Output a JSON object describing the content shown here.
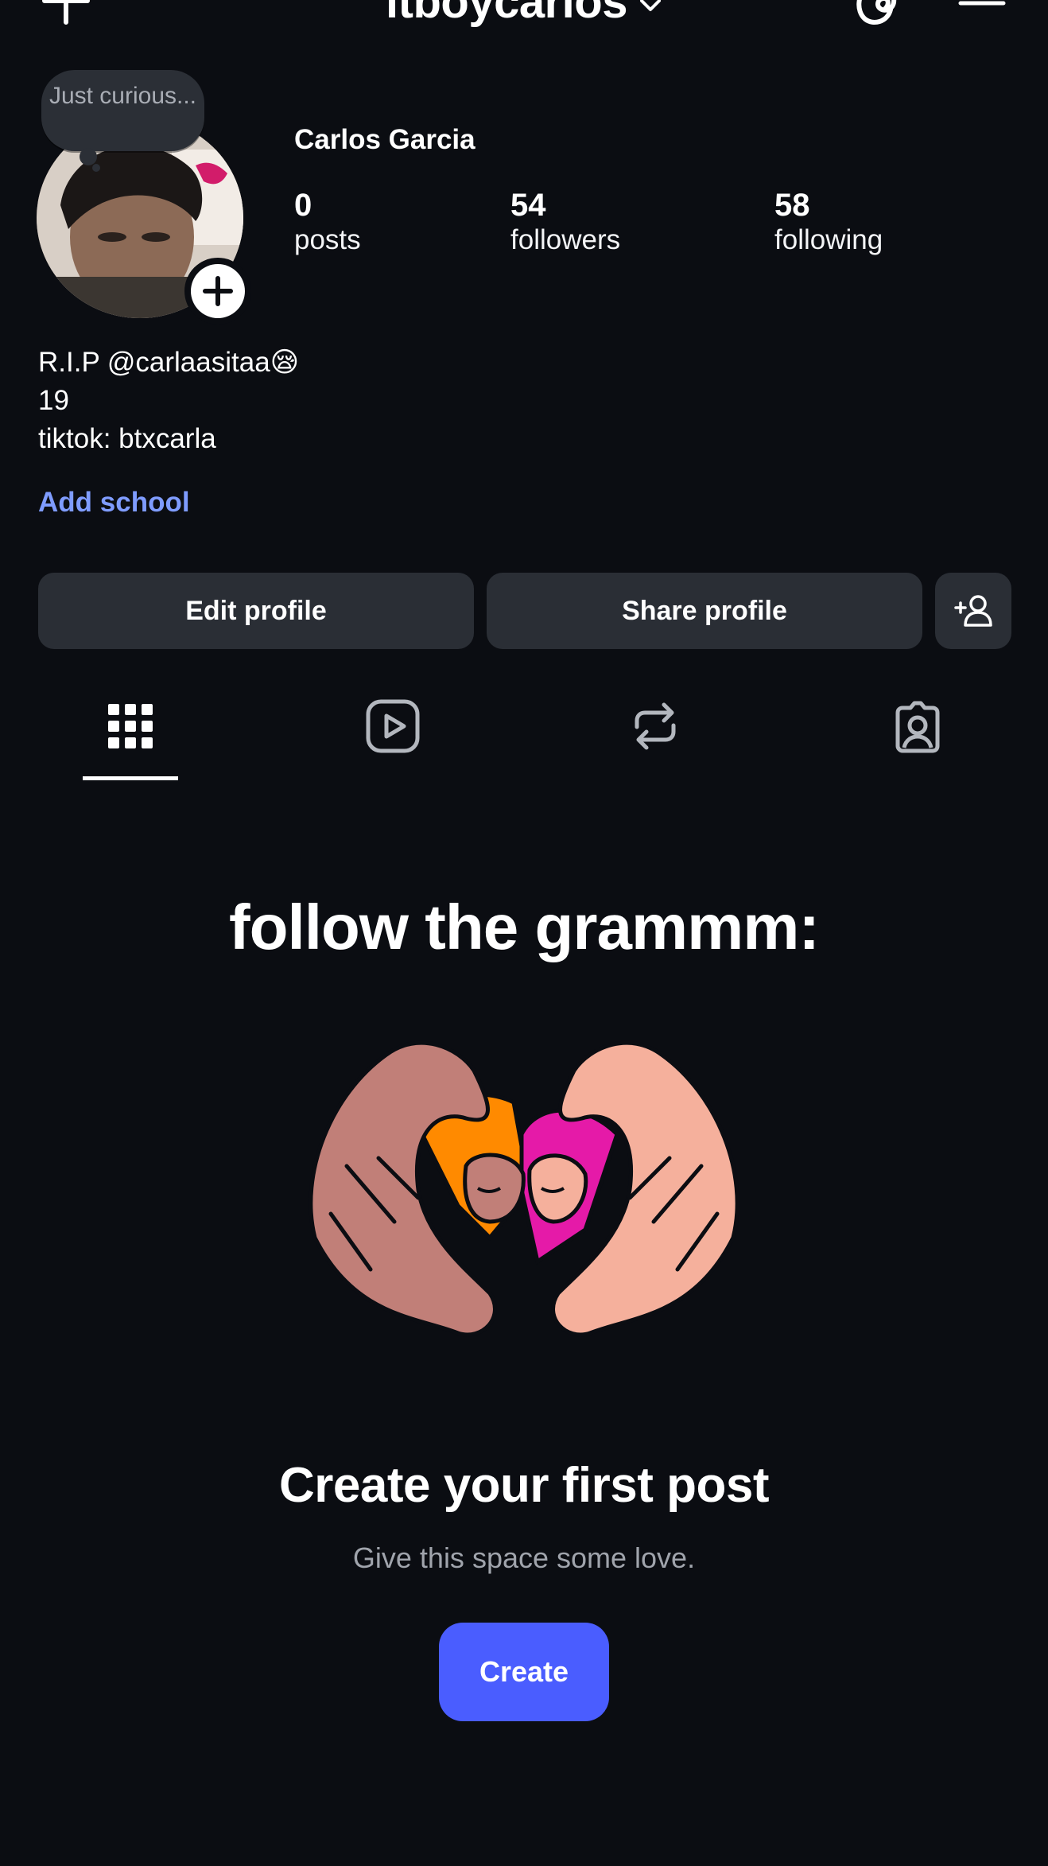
{
  "header": {
    "username": "itboycarlos"
  },
  "profile": {
    "note": "Just curious...",
    "full_name": "Carlos Garcia",
    "stats": [
      {
        "value": "0",
        "label": "posts"
      },
      {
        "value": "54",
        "label": "followers"
      },
      {
        "value": "58",
        "label": "following"
      }
    ],
    "bio_lines": [
      "R.I.P @carlaasitaa😪",
      "19",
      "tiktok: btxcarla"
    ],
    "add_school": "Add school"
  },
  "actions": {
    "edit_profile": "Edit profile",
    "share_profile": "Share profile"
  },
  "tabs": [
    {
      "icon": "grid-icon",
      "active": true
    },
    {
      "icon": "reels-icon",
      "active": false
    },
    {
      "icon": "reposts-icon",
      "active": false
    },
    {
      "icon": "tagged-icon",
      "active": false
    }
  ],
  "empty_state": {
    "banner": "follow the grammm:",
    "title": "Create your first post",
    "subtitle": "Give this space some love.",
    "button": "Create"
  },
  "colors": {
    "background": "#0b0d12",
    "button_bg": "#2a2e35",
    "link": "#7f9cff",
    "primary": "#4a5dff"
  }
}
